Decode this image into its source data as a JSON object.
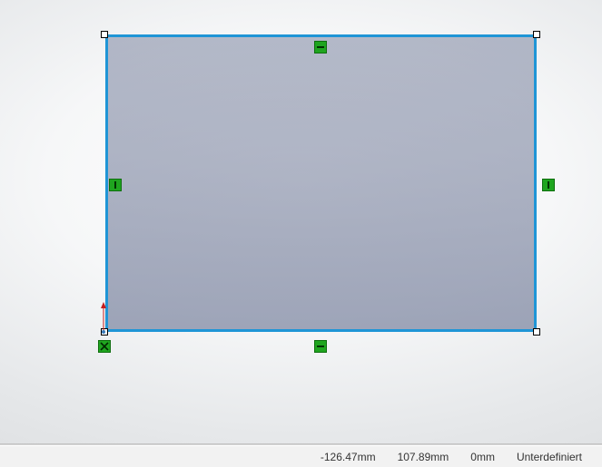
{
  "status": {
    "x": "-126.47mm",
    "y": "107.89mm",
    "z": "0mm",
    "def_state": "Unterdefiniert"
  },
  "sketch": {
    "relations": {
      "top": "horizontal",
      "bottom": "horizontal",
      "left": "vertical",
      "right": "vertical",
      "origin": "fixed"
    }
  }
}
